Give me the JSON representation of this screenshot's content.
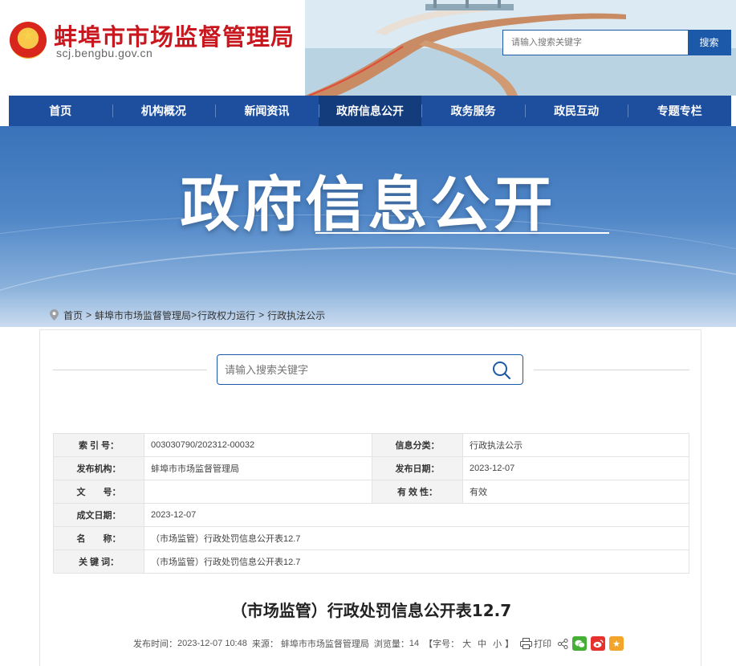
{
  "site": {
    "name": "蚌埠市市场监督管理局",
    "domain": "scj.bengbu.gov.cn"
  },
  "top_search": {
    "placeholder": "请输入搜索关键字",
    "button_label": "搜索"
  },
  "nav": {
    "items": [
      {
        "label": "首页"
      },
      {
        "label": "机构概况"
      },
      {
        "label": "新闻资讯"
      },
      {
        "label": "政府信息公开"
      },
      {
        "label": "政务服务"
      },
      {
        "label": "政民互动"
      },
      {
        "label": "专题专栏"
      }
    ],
    "active_index": 3
  },
  "banner": {
    "title": "政府信息公开"
  },
  "breadcrumb": {
    "items": [
      "首页",
      "蚌埠市市场监督管理局",
      "行政权力运行",
      "行政执法公示"
    ],
    "separators": [
      ">",
      ">",
      ">"
    ]
  },
  "inner_search": {
    "placeholder": "请输入搜索关键字"
  },
  "info_table": {
    "index_label": "索 引 号：",
    "index_value": "003030790/202312-00032",
    "category_label": "信息分类：",
    "category_value": "行政执法公示",
    "publisher_label": "发布机构：",
    "publisher_value": "蚌埠市市场监督管理局",
    "publish_date_label": "发布日期：",
    "publish_date_value": "2023-12-07",
    "doc_no_label": "文　　号：",
    "doc_no_value": "",
    "validity_label": "有 效 性：",
    "validity_value": "有效",
    "created_label": "成文日期：",
    "created_value": "2023-12-07",
    "name_label": "名　　称：",
    "name_value": "（市场监管）行政处罚信息公开表12.7",
    "keywords_label": "关 键 词：",
    "keywords_value": "（市场监管）行政处罚信息公开表12.7"
  },
  "article": {
    "title": "（市场监管）行政处罚信息公开表12.7",
    "publish_time_label": "发布时间：",
    "publish_time": "2023-12-07 10:48",
    "source_label": "来源：",
    "source": "蚌埠市市场监督管理局",
    "views_label": "浏览量：",
    "views": "14",
    "font_size_open": "【字号：",
    "font_large": "大",
    "font_medium": "中",
    "font_small": "小",
    "font_size_close": "】",
    "print_label": "打印"
  },
  "colors": {
    "brand_red": "#c8171e",
    "nav_blue": "#1d4f9e",
    "nav_active": "#133c7d"
  }
}
